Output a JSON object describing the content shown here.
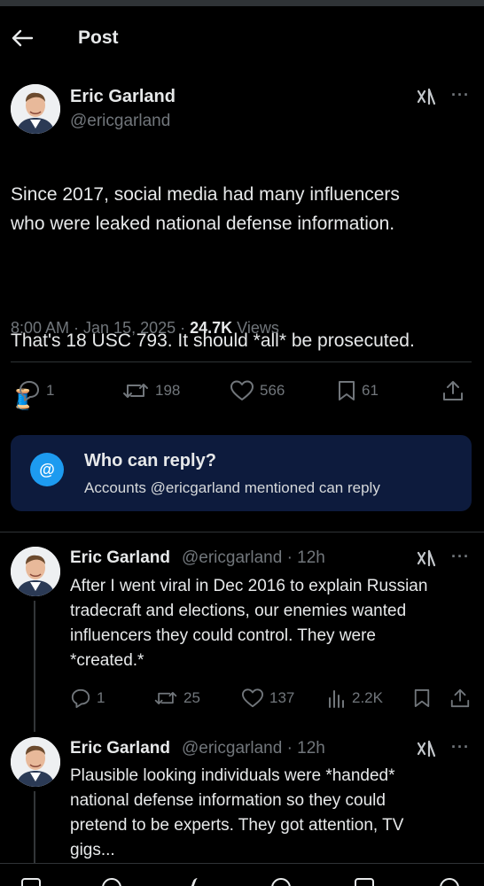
{
  "header": {
    "title": "Post"
  },
  "post": {
    "author_name": "Eric Garland",
    "author_handle": "@ericgarland",
    "text_line1": "Since 2017, social media had many influencers\nwho were leaked national defense information.",
    "text_line2": "That's 18 USC 793. It should *all* be prosecuted.",
    "emoji": "🧵",
    "time": "8:00 AM · Jan 15, 2025 · ",
    "views_count": "24.7K",
    "views_label": " Views",
    "stats": {
      "replies": "1",
      "reposts": "198",
      "likes": "566",
      "bookmarks": "61"
    }
  },
  "who_can_reply": {
    "title": "Who can reply?",
    "subtitle": "Accounts @ericgarland mentioned can reply",
    "icon": "@"
  },
  "replies": [
    {
      "author_name": "Eric Garland",
      "meta": "@ericgarland · 12h",
      "text": "After I went viral in Dec 2016 to explain Russian\ntradecraft and elections, our enemies wanted\ninfluencers they could control. They were\n*created.*",
      "stats": {
        "replies": "1",
        "reposts": "25",
        "likes": "137",
        "views": "2.2K"
      }
    },
    {
      "author_name": "Eric Garland",
      "meta": "@ericgarland · 12h",
      "text": "Plausible looking individuals were *handed*\nnational defense information so they could\npretend to be experts. They got attention, TV\ngigs..."
    }
  ],
  "colors": {
    "accent": "#1d9bf0",
    "muted": "#71767b",
    "reply_box": "#0d1b3d"
  }
}
